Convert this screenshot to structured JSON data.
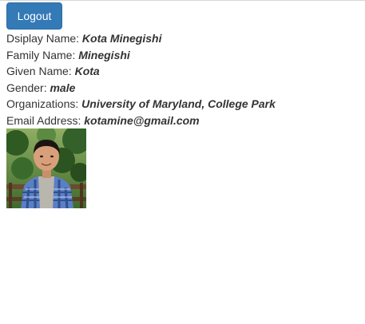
{
  "header": {
    "logout_label": "Logout"
  },
  "profile": {
    "fields": [
      {
        "label": "Dsiplay Name: ",
        "value": "Kota Minegishi"
      },
      {
        "label": "Family Name: ",
        "value": "Minegishi"
      },
      {
        "label": "Given Name: ",
        "value": "Kota"
      },
      {
        "label": "Gender: ",
        "value": "male"
      },
      {
        "label": "Organizations: ",
        "value": "University of Maryland, College Park"
      },
      {
        "label": "Email Address: ",
        "value": "kotamine@gmail.com"
      }
    ]
  },
  "colors": {
    "button_bg": "#337ab7",
    "button_border": "#2e6da4",
    "text": "#333333"
  }
}
